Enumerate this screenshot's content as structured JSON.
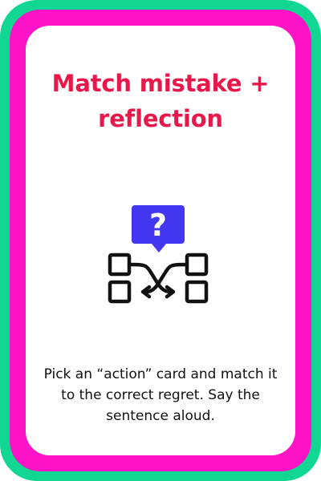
{
  "card": {
    "title": "Match mistake +\nreflection",
    "instruction": "Pick an “action” card and match it to the correct regret. Say the sentence aloud.",
    "icon": "match-arrows-question-icon"
  },
  "colors": {
    "outer_border": "#12d793",
    "inner_border": "#fd14c6",
    "title": "#e8184a",
    "icon_accent": "#4437f2",
    "icon_line": "#111111"
  }
}
